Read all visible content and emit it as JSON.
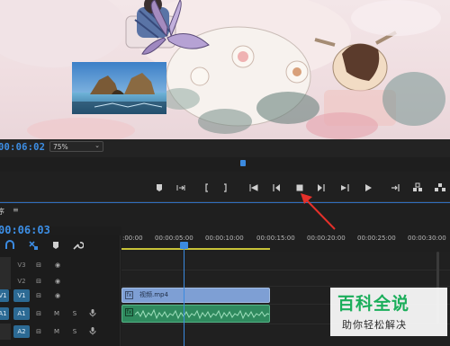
{
  "colors": {
    "accent": "#3b8ae0",
    "timecode": "#3d8fe6",
    "video_clip": "#7e9fd4",
    "audio_clip": "#2f8a5e",
    "work_area": "#c7c238",
    "annotation": "#e5302a",
    "watermark_green": "#1bae5b"
  },
  "program_monitor": {
    "timecode": "00:06:02",
    "zoom": "75%"
  },
  "timeline": {
    "tab_label": "序",
    "timecode": "00:06:03",
    "ruler_labels": [
      ":00:00",
      "00:00:05:00",
      "00:00:10:00",
      "00:00:15:00",
      "00:00:20:00",
      "00:00:25:00",
      "00:00:30:00"
    ],
    "tracks": {
      "v3": "V3",
      "v2": "V2",
      "v1": "V1",
      "v1_src": "V1",
      "a1": "A1",
      "a1_src": "A1",
      "a2": "A2",
      "m": "M",
      "s": "S"
    },
    "video_clip_label": "视频.mp4",
    "fx_label": "fx"
  },
  "watermark": {
    "title": "百科全说",
    "subtitle": "助你轻松解决"
  }
}
